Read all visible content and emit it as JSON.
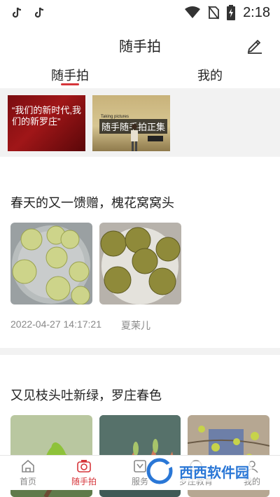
{
  "status_bar": {
    "time": "2:18",
    "icons": [
      "tiktok-icon",
      "tiktok-icon",
      "wifi-icon",
      "no-sim-icon",
      "battery-charging-icon"
    ]
  },
  "header": {
    "title": "随手拍",
    "edit_icon": "pencil-icon"
  },
  "tabs": [
    {
      "label": "随手拍",
      "active": true
    },
    {
      "label": "我的",
      "active": false
    }
  ],
  "videos": [
    {
      "caption": "“我们的新时代,我们的新罗庄”"
    },
    {
      "caption": "随手随手拍正集",
      "sub_en": "Taking pictures"
    }
  ],
  "posts": [
    {
      "title": "春天的又一馈赠，槐花窝窝头",
      "timestamp": "2022-04-27 14:17:21",
      "author": "夏茉儿"
    },
    {
      "title": "又见枝头吐新绿，罗庄春色",
      "timestamp": "",
      "author": ""
    }
  ],
  "bottom_nav": [
    {
      "label": "首页",
      "icon": "home-icon",
      "active": false
    },
    {
      "label": "随手拍",
      "icon": "camera-icon",
      "active": true
    },
    {
      "label": "服务",
      "icon": "service-icon",
      "active": false
    },
    {
      "label": "罗庄教育",
      "icon": "education-icon",
      "active": false
    },
    {
      "label": "我的",
      "icon": "profile-icon",
      "active": false
    }
  ],
  "watermark": {
    "text": "西西软件园"
  },
  "colors": {
    "accent": "#d6353a",
    "meta": "#888888",
    "divider": "#f2f2f2"
  }
}
